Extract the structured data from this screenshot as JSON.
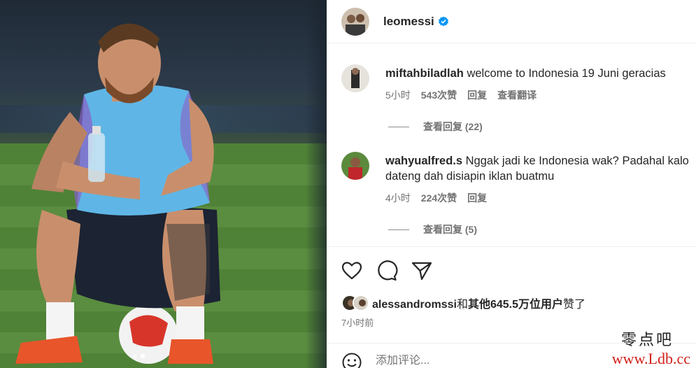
{
  "post": {
    "owner": "leomessi",
    "verified_color": "#0095f6"
  },
  "comments": [
    {
      "user": "miftahbiladlah",
      "text": "welcome to Indonesia 19 Juni geracias",
      "time": "5小时",
      "likes": "543次赞",
      "reply": "回复",
      "translate": "查看翻译",
      "view_replies": "查看回复 (22)"
    },
    {
      "user": "wahyualfred.s",
      "text": "Nggak jadi ke Indonesia wak? Padahal kalo dateng dah disiapin iklan buatmu",
      "time": "4小时",
      "likes": "224次赞",
      "reply": "回复",
      "view_replies": "查看回复 (5)"
    }
  ],
  "likes": {
    "user": "alessandromssi",
    "connector": "和",
    "others": "其他645.5万位用户",
    "suffix": "赞了"
  },
  "timestamp": "7小时前",
  "add_comment": {
    "placeholder": "添加评论..."
  },
  "watermark": {
    "line1": "零点吧",
    "line2": "www.Ldb.cc"
  },
  "icons": [
    "heart-icon",
    "comment-icon",
    "share-icon",
    "smile-icon",
    "verified-icon"
  ]
}
